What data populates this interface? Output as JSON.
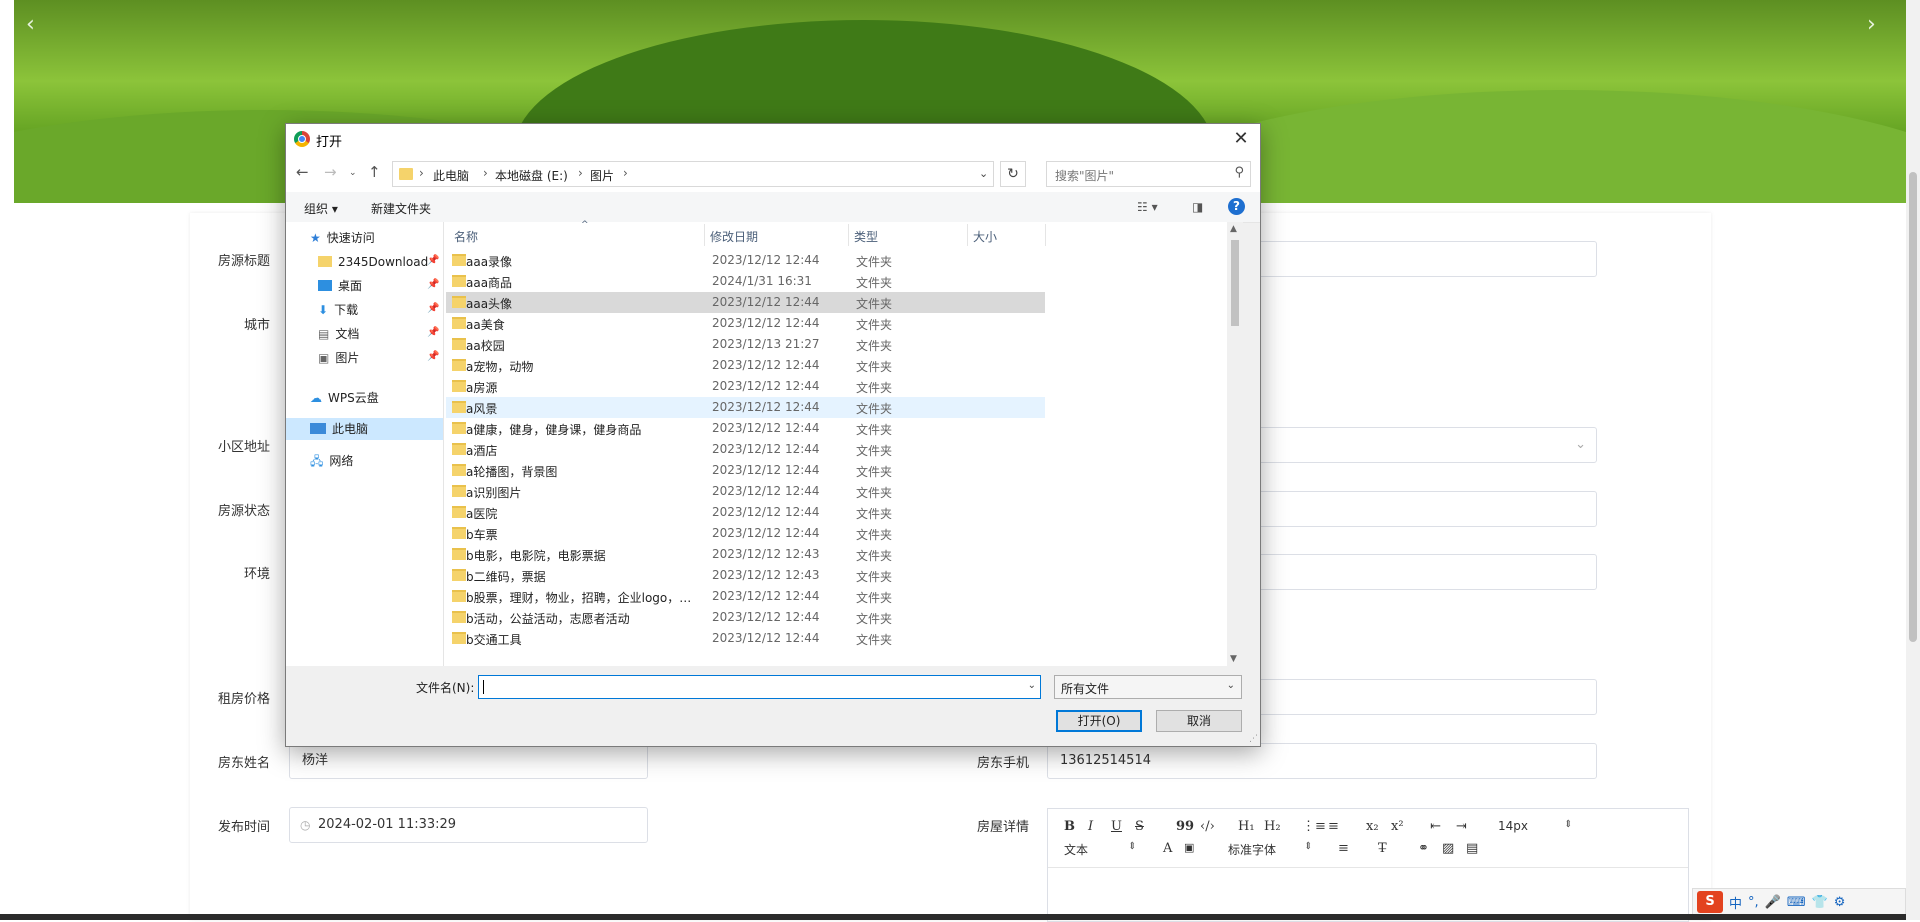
{
  "background": {
    "form_labels": {
      "title": "房源标题",
      "city": "城市",
      "address": "小区地址",
      "status": "房源状态",
      "environment": "环境",
      "price": "租房价格",
      "landlord_name": "房东姓名",
      "landlord_phone": "房东手机",
      "publish_time": "发布时间",
      "details": "房屋详情"
    },
    "values": {
      "landlord_name": "杨洋",
      "landlord_phone": "13612514514",
      "publish_time": "2024-02-01 11:33:29"
    },
    "editor": {
      "bold": "B",
      "italic": "I",
      "underline": "U",
      "strike": "S",
      "quote": "99",
      "code": "‹/›",
      "h1": "H₁",
      "h2": "H₂",
      "ol": "⋮≡",
      "ul": "≡",
      "sub": "x₂",
      "sup": "x²",
      "indent_out": "⇤",
      "indent_in": "⇥",
      "font_size": "14px",
      "text_style": "文本",
      "font_family": "标准字体"
    },
    "ime": {
      "logo": "S",
      "lang": "中"
    }
  },
  "dialog": {
    "title": "打开",
    "breadcrumb": [
      "此电脑",
      "本地磁盘 (E:)",
      "图片"
    ],
    "search_placeholder": "搜索\"图片\"",
    "organize_label": "组织 ▾",
    "new_folder_label": "新建文件夹",
    "help_label": "?",
    "nav_pane": {
      "quick_access": "快速访问",
      "items": [
        "2345Download",
        "桌面",
        "下载",
        "文档",
        "图片"
      ],
      "wps": "WPS云盘",
      "this_pc": "此电脑",
      "network": "网络"
    },
    "columns": {
      "name": "名称",
      "date": "修改日期",
      "type": "类型",
      "size": "大小"
    },
    "files": [
      {
        "name": "aaa录像",
        "date": "2023/12/12 12:44",
        "type": "文件夹"
      },
      {
        "name": "aaa商品",
        "date": "2024/1/31 16:31",
        "type": "文件夹"
      },
      {
        "name": "aaa头像",
        "date": "2023/12/12 12:44",
        "type": "文件夹"
      },
      {
        "name": "aa美食",
        "date": "2023/12/12 12:44",
        "type": "文件夹"
      },
      {
        "name": "aa校园",
        "date": "2023/12/13 21:27",
        "type": "文件夹"
      },
      {
        "name": "a宠物，动物",
        "date": "2023/12/12 12:44",
        "type": "文件夹"
      },
      {
        "name": "a房源",
        "date": "2023/12/12 12:44",
        "type": "文件夹"
      },
      {
        "name": "a风景",
        "date": "2023/12/12 12:44",
        "type": "文件夹"
      },
      {
        "name": "a健康，健身，健身课，健身商品",
        "date": "2023/12/12 12:44",
        "type": "文件夹"
      },
      {
        "name": "a酒店",
        "date": "2023/12/12 12:44",
        "type": "文件夹"
      },
      {
        "name": "a轮播图，背景图",
        "date": "2023/12/12 12:44",
        "type": "文件夹"
      },
      {
        "name": "a识别图片",
        "date": "2023/12/12 12:44",
        "type": "文件夹"
      },
      {
        "name": "a医院",
        "date": "2023/12/12 12:44",
        "type": "文件夹"
      },
      {
        "name": "b车票",
        "date": "2023/12/12 12:44",
        "type": "文件夹"
      },
      {
        "name": "b电影，电影院，电影票据",
        "date": "2023/12/12 12:43",
        "type": "文件夹"
      },
      {
        "name": "b二维码，票据",
        "date": "2023/12/12 12:43",
        "type": "文件夹"
      },
      {
        "name": "b股票，理财，物业，招聘，企业logo，…",
        "date": "2023/12/12 12:44",
        "type": "文件夹"
      },
      {
        "name": "b活动，公益活动，志愿者活动",
        "date": "2023/12/12 12:44",
        "type": "文件夹"
      },
      {
        "name": "b交通工具",
        "date": "2023/12/12 12:44",
        "type": "文件夹"
      }
    ],
    "selected_index": 2,
    "hover_index": 7,
    "filename_label": "文件名(N):",
    "filename_value": "",
    "filter_value": "所有文件",
    "open_label": "打开(O)",
    "cancel_label": "取消"
  }
}
